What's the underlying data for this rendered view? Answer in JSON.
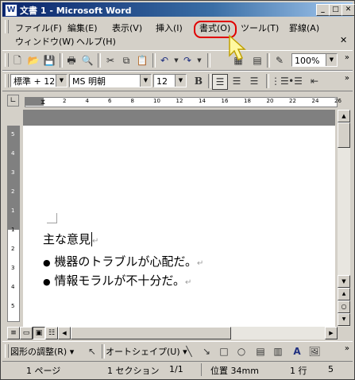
{
  "window": {
    "title": "文書 1 - Microsoft Word",
    "app_icon": "W"
  },
  "menu": {
    "file": "ファイル(F)",
    "edit": "編集(E)",
    "view": "表示(V)",
    "insert": "挿入(I)",
    "format": "書式(O)",
    "tools": "ツール(T)",
    "table": "罫線(A)",
    "window": "ウィンドウ(W)",
    "help": "ヘルプ(H)"
  },
  "toolbar": {
    "zoom": "100%"
  },
  "formatting": {
    "style": "標準 + 12",
    "font": "MS 明朝",
    "size": "12",
    "bold": "B"
  },
  "ruler": {
    "ticks": [
      "2",
      "4",
      "6",
      "8",
      "10",
      "12",
      "14",
      "16",
      "18",
      "20",
      "22",
      "24",
      "26"
    ],
    "vticks": [
      "5",
      "4",
      "3",
      "2",
      "1",
      "1",
      "2",
      "3",
      "4",
      "5"
    ]
  },
  "document": {
    "lines": [
      "主な意見",
      "機器のトラブルが心配だ。",
      "情報モラルが不十分だ。"
    ],
    "bullet": "●",
    "return_mark": "↵"
  },
  "drawing": {
    "draw_menu": "図形の調整(R)",
    "autoshape": "オートシェイプ(U)"
  },
  "status": {
    "page": "1 ページ",
    "section": "1 セクション",
    "pages": "1/1",
    "position": "位置 34mm",
    "line": "1 行",
    "column": "5"
  }
}
